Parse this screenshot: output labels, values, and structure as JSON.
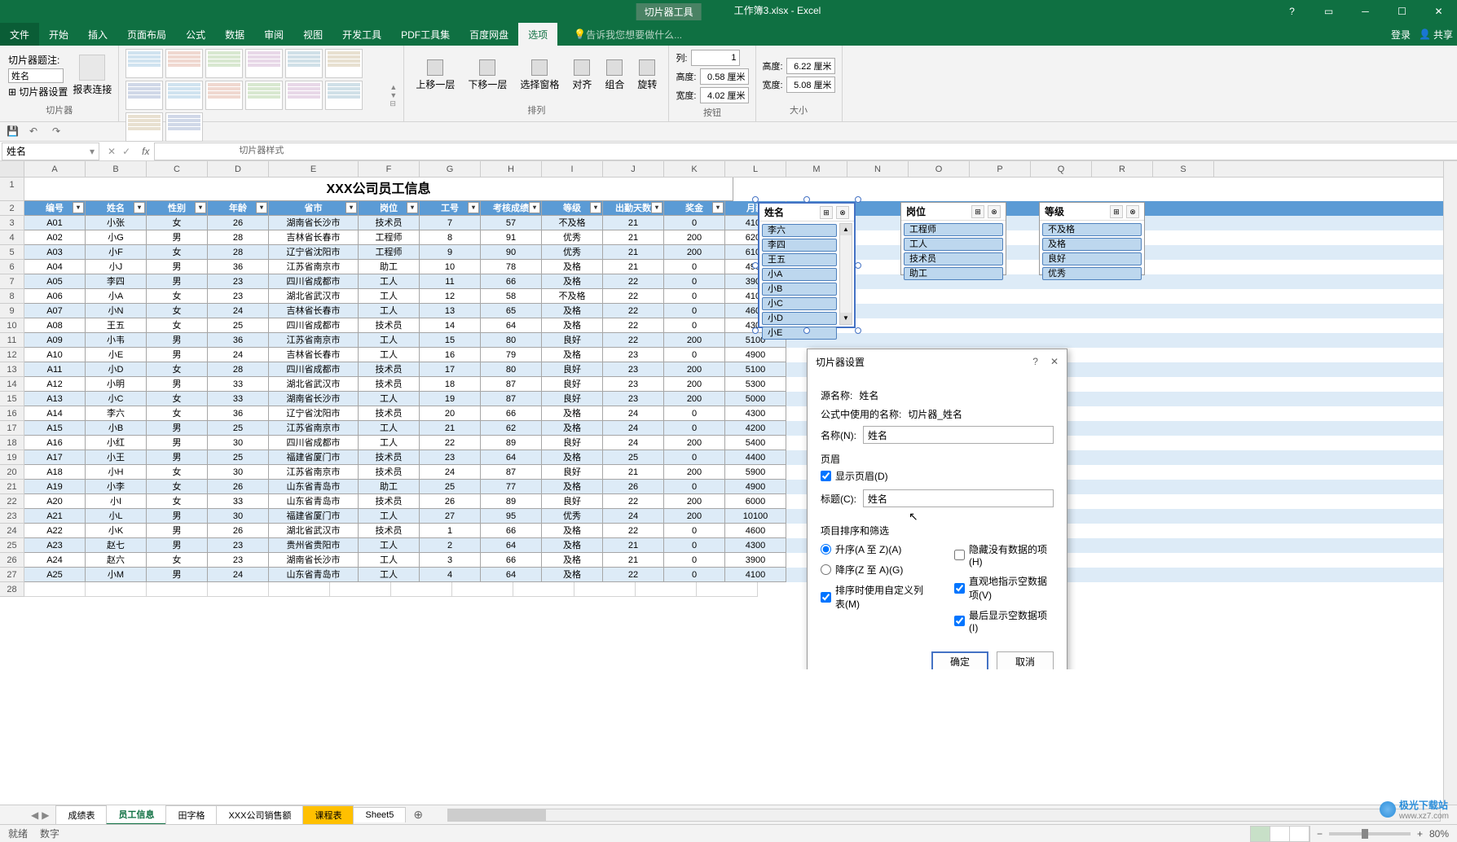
{
  "titlebar": {
    "tool_tab": "切片器工具",
    "filename": "工作簿3.xlsx - Excel"
  },
  "menu": {
    "file": "文件",
    "home": "开始",
    "insert": "插入",
    "layout": "页面布局",
    "formula": "公式",
    "data": "数据",
    "review": "审阅",
    "view": "视图",
    "dev": "开发工具",
    "pdf": "PDF工具集",
    "baidu": "百度网盘",
    "options": "选项",
    "tellme": "告诉我您想要做什么...",
    "login": "登录",
    "share": "共享"
  },
  "ribbon": {
    "caption_label": "切片器题注:",
    "caption_value": "姓名",
    "settings": "切片器设置",
    "report": "报表连接",
    "g1": "切片器",
    "g2": "切片器样式",
    "g3": "排列",
    "g4": "按钮",
    "g5": "大小",
    "bring": "上移一层",
    "send": "下移一层",
    "pane": "选择窗格",
    "align": "对齐",
    "group": "组合",
    "rotate": "旋转",
    "cols": "列:",
    "cols_v": "1",
    "height": "高度:",
    "height_v": "0.58 厘米",
    "width": "宽度:",
    "width_v": "4.02 厘米",
    "sheight": "高度:",
    "sheight_v": "6.22 厘米",
    "swidth": "宽度:",
    "swidth_v": "5.08 厘米"
  },
  "namebox": "姓名",
  "columns": [
    "A",
    "B",
    "C",
    "D",
    "E",
    "F",
    "G",
    "H",
    "I",
    "J",
    "K",
    "L",
    "M",
    "N",
    "O",
    "P",
    "Q",
    "R",
    "S"
  ],
  "table": {
    "title": "XXX公司员工信息",
    "headers": [
      "编号",
      "姓名",
      "性别",
      "年龄",
      "省市",
      "岗位",
      "工号",
      "考核成绩",
      "等级",
      "出勤天数",
      "奖金",
      "月薪"
    ],
    "rows": [
      [
        "A01",
        "小张",
        "女",
        "26",
        "湖南省长沙市",
        "技术员",
        "7",
        "57",
        "不及格",
        "21",
        "0",
        "4100"
      ],
      [
        "A02",
        "小G",
        "男",
        "28",
        "吉林省长春市",
        "工程师",
        "8",
        "91",
        "优秀",
        "21",
        "200",
        "6200"
      ],
      [
        "A03",
        "小F",
        "女",
        "28",
        "辽宁省沈阳市",
        "工程师",
        "9",
        "90",
        "优秀",
        "21",
        "200",
        "6100"
      ],
      [
        "A04",
        "小J",
        "男",
        "36",
        "江苏省南京市",
        "助工",
        "10",
        "78",
        "及格",
        "21",
        "0",
        "4900"
      ],
      [
        "A05",
        "李四",
        "男",
        "23",
        "四川省成都市",
        "工人",
        "11",
        "66",
        "及格",
        "22",
        "0",
        "3900"
      ],
      [
        "A06",
        "小A",
        "女",
        "23",
        "湖北省武汉市",
        "工人",
        "12",
        "58",
        "不及格",
        "22",
        "0",
        "4100"
      ],
      [
        "A07",
        "小N",
        "女",
        "24",
        "吉林省长春市",
        "工人",
        "13",
        "65",
        "及格",
        "22",
        "0",
        "4600"
      ],
      [
        "A08",
        "王五",
        "女",
        "25",
        "四川省成都市",
        "技术员",
        "14",
        "64",
        "及格",
        "22",
        "0",
        "4300"
      ],
      [
        "A09",
        "小韦",
        "男",
        "36",
        "江苏省南京市",
        "工人",
        "15",
        "80",
        "良好",
        "22",
        "200",
        "5100"
      ],
      [
        "A10",
        "小E",
        "男",
        "24",
        "吉林省长春市",
        "工人",
        "16",
        "79",
        "及格",
        "23",
        "0",
        "4900"
      ],
      [
        "A11",
        "小D",
        "女",
        "28",
        "四川省成都市",
        "技术员",
        "17",
        "80",
        "良好",
        "23",
        "200",
        "5100"
      ],
      [
        "A12",
        "小明",
        "男",
        "33",
        "湖北省武汉市",
        "技术员",
        "18",
        "87",
        "良好",
        "23",
        "200",
        "5300"
      ],
      [
        "A13",
        "小C",
        "女",
        "33",
        "湖南省长沙市",
        "工人",
        "19",
        "87",
        "良好",
        "23",
        "200",
        "5000"
      ],
      [
        "A14",
        "李六",
        "女",
        "36",
        "辽宁省沈阳市",
        "技术员",
        "20",
        "66",
        "及格",
        "24",
        "0",
        "4300"
      ],
      [
        "A15",
        "小B",
        "男",
        "25",
        "江苏省南京市",
        "工人",
        "21",
        "62",
        "及格",
        "24",
        "0",
        "4200"
      ],
      [
        "A16",
        "小红",
        "男",
        "30",
        "四川省成都市",
        "工人",
        "22",
        "89",
        "良好",
        "24",
        "200",
        "5400"
      ],
      [
        "A17",
        "小王",
        "男",
        "25",
        "福建省厦门市",
        "技术员",
        "23",
        "64",
        "及格",
        "25",
        "0",
        "4400"
      ],
      [
        "A18",
        "小H",
        "女",
        "30",
        "江苏省南京市",
        "技术员",
        "24",
        "87",
        "良好",
        "21",
        "200",
        "5900"
      ],
      [
        "A19",
        "小李",
        "女",
        "26",
        "山东省青岛市",
        "助工",
        "25",
        "77",
        "及格",
        "26",
        "0",
        "4900"
      ],
      [
        "A20",
        "小I",
        "女",
        "33",
        "山东省青岛市",
        "技术员",
        "26",
        "89",
        "良好",
        "22",
        "200",
        "6000"
      ],
      [
        "A21",
        "小L",
        "男",
        "30",
        "福建省厦门市",
        "工人",
        "27",
        "95",
        "优秀",
        "24",
        "200",
        "10100"
      ],
      [
        "A22",
        "小K",
        "男",
        "26",
        "湖北省武汉市",
        "技术员",
        "1",
        "66",
        "及格",
        "22",
        "0",
        "4600"
      ],
      [
        "A23",
        "赵七",
        "男",
        "23",
        "贵州省贵阳市",
        "工人",
        "2",
        "64",
        "及格",
        "21",
        "0",
        "4300"
      ],
      [
        "A24",
        "赵六",
        "女",
        "23",
        "湖南省长沙市",
        "工人",
        "3",
        "66",
        "及格",
        "21",
        "0",
        "3900"
      ],
      [
        "A25",
        "小M",
        "男",
        "24",
        "山东省青岛市",
        "工人",
        "4",
        "64",
        "及格",
        "22",
        "0",
        "4100"
      ]
    ]
  },
  "slicers": {
    "name": {
      "title": "姓名",
      "items": [
        "李六",
        "李四",
        "王五",
        "小A",
        "小B",
        "小C",
        "小D",
        "小E"
      ]
    },
    "post": {
      "title": "岗位",
      "items": [
        "工程师",
        "工人",
        "技术员",
        "助工"
      ]
    },
    "grade": {
      "title": "等级",
      "items": [
        "不及格",
        "及格",
        "良好",
        "优秀"
      ]
    }
  },
  "dialog": {
    "title": "切片器设置",
    "src_label": "源名称:",
    "src_value": "姓名",
    "formula_label": "公式中使用的名称:",
    "formula_value": "切片器_姓名",
    "name_label": "名称(N):",
    "name_value": "姓名",
    "header_section": "页眉",
    "show_header": "显示页眉(D)",
    "caption_label": "标题(C):",
    "caption_value": "姓名",
    "sort_section": "项目排序和筛选",
    "asc": "升序(A 至 Z)(A)",
    "desc": "降序(Z 至 A)(G)",
    "custom": "排序时使用自定义列表(M)",
    "hide_nodata": "隐藏没有数据的项(H)",
    "visual_empty": "直观地指示空数据项(V)",
    "show_last": "最后显示空数据项(I)",
    "ok": "确定",
    "cancel": "取消"
  },
  "tabs": {
    "t1": "成绩表",
    "t2": "员工信息",
    "t3": "田字格",
    "t4": "XXX公司销售额",
    "t5": "课程表",
    "t6": "Sheet5"
  },
  "status": {
    "ready": "就绪",
    "num": "数字",
    "zoom": "80%"
  },
  "watermark": {
    "name": "极光下载站",
    "url": "www.xz7.com"
  }
}
